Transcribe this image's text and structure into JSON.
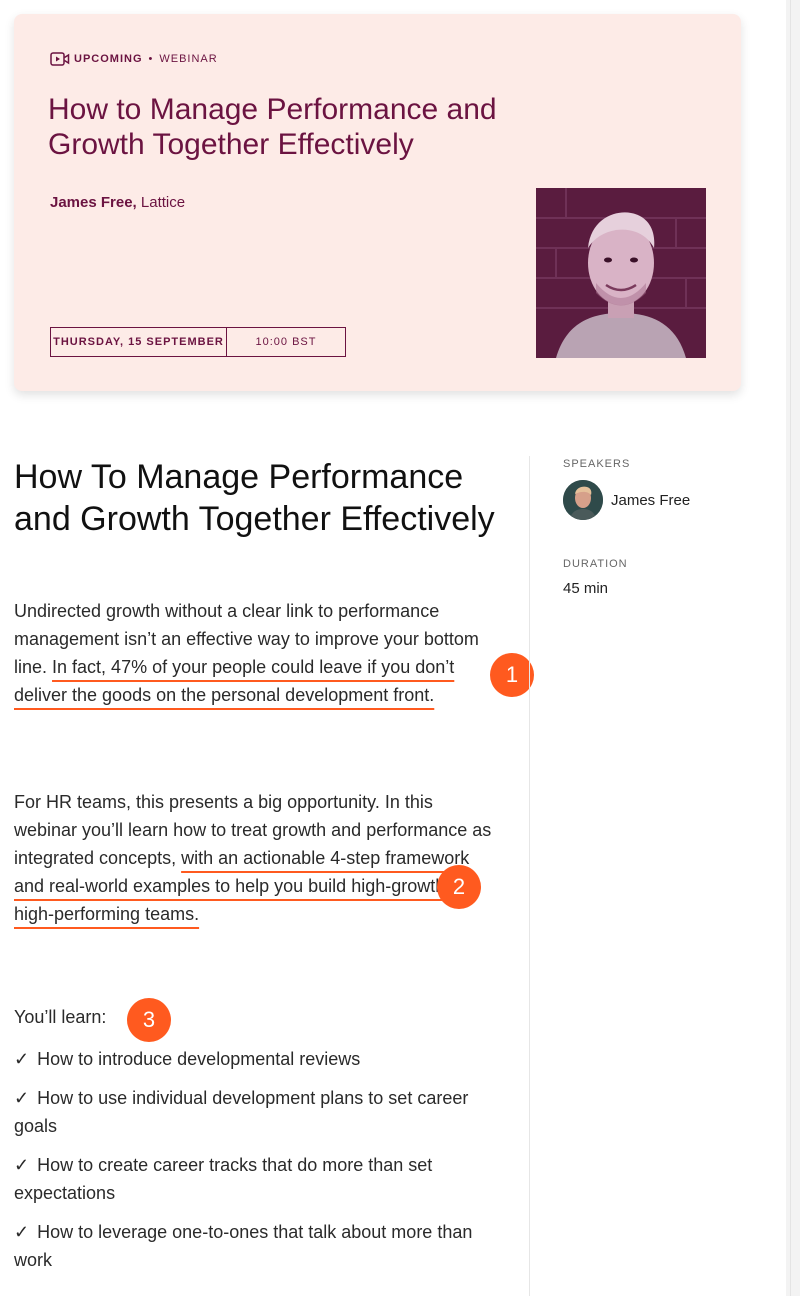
{
  "hero": {
    "badge": "UPCOMING",
    "type": "WEBINAR",
    "title": "How to Manage Performance and Growth Together Effectively",
    "host_name": "James Free,",
    "host_company": " Lattice",
    "date": "THURSDAY, 15 SEPTEMBER",
    "time": "10:00 BST",
    "icon": "video-icon"
  },
  "content": {
    "title": "How To Manage Performance and Growth Together Effectively",
    "p1_plain": "Undirected growth without a clear link to performance management isn’t an effective way to improve your bottom line. ",
    "p1_highlight": "In fact, 47% of your people could leave if you don’t deliver the goods on the personal development front.",
    "p2_plain": "For HR teams, this presents a big opportunity.  In this webinar you’ll learn how to treat growth and performance as integrated concepts, ",
    "p2_highlight": "with an actionable 4-step framework and real-world examples to help you build high-growth, high-performing teams.",
    "learn_heading": "You’ll learn:",
    "check": "✓",
    "learn_items": [
      "How to introduce developmental reviews",
      "How to use individual development plans to set career goals",
      "How to create career tracks that do more than set expectations",
      "How to leverage one-to-ones that talk about more than work"
    ]
  },
  "annotations": [
    "1",
    "2",
    "3"
  ],
  "sidebar": {
    "speakers_label": "SPEAKERS",
    "speaker_name": "James Free",
    "duration_label": "DURATION",
    "duration_value": "45 min"
  },
  "colors": {
    "brand": "#6b1341",
    "hero_bg": "#fdebe7",
    "accent": "#ff5a1f"
  }
}
